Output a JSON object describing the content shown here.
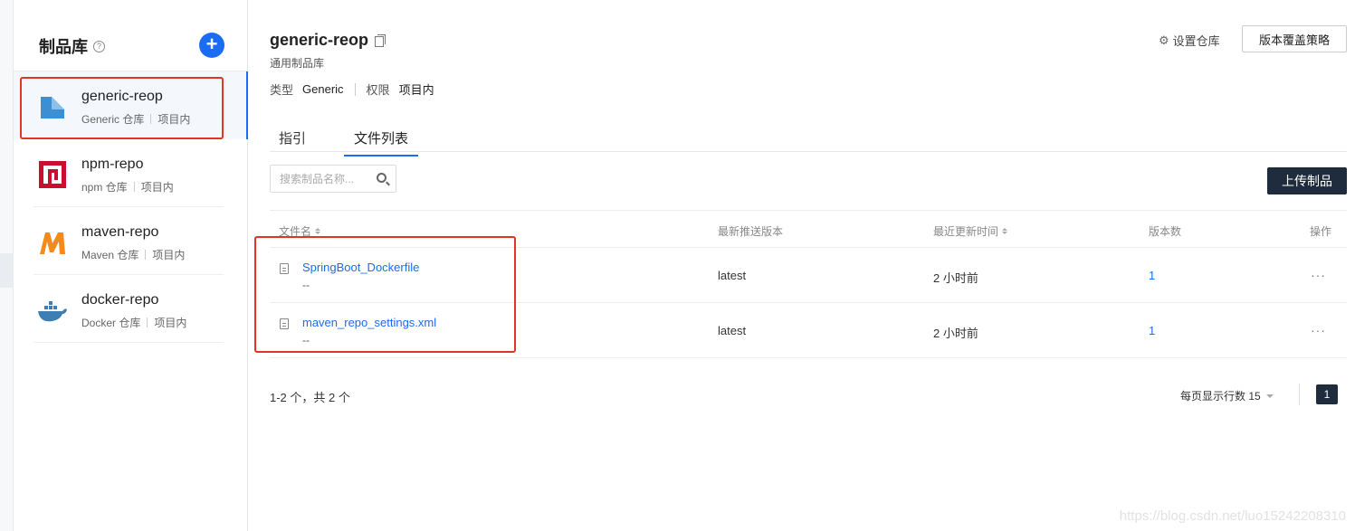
{
  "sidebar": {
    "title": "制品库",
    "help_icon": "?",
    "add_label": "+",
    "items": [
      {
        "name": "generic-reop",
        "type": "Generic 仓库",
        "scope": "项目内",
        "icon": "generic-folder-icon",
        "color": "#3b8fd4"
      },
      {
        "name": "npm-repo",
        "type": "npm 仓库",
        "scope": "项目内",
        "icon": "npm-icon",
        "color": "#c8102e"
      },
      {
        "name": "maven-repo",
        "type": "Maven 仓库",
        "scope": "项目内",
        "icon": "maven-icon",
        "color": "#f28a1e"
      },
      {
        "name": "docker-repo",
        "type": "Docker 仓库",
        "scope": "项目内",
        "icon": "docker-icon",
        "color": "#3d7fb5"
      }
    ]
  },
  "header": {
    "title": "generic-reop",
    "subtitle": "通用制品库",
    "type_label": "类型",
    "type_value": "Generic",
    "perm_label": "权限",
    "perm_value": "项目内",
    "settings_label": "设置仓库",
    "policy_label": "版本覆盖策略"
  },
  "tabs": [
    {
      "label": "指引"
    },
    {
      "label": "文件列表"
    }
  ],
  "toolbar": {
    "search_placeholder": "搜索制品名称...",
    "upload_label": "上传制品"
  },
  "table": {
    "columns": [
      "文件名",
      "最新推送版本",
      "最近更新时间",
      "版本数",
      "操作"
    ],
    "rows": [
      {
        "name": "SpringBoot_Dockerfile",
        "sub": "--",
        "version": "latest",
        "updated": "2 小时前",
        "count": "1",
        "more": "···"
      },
      {
        "name": "maven_repo_settings.xml",
        "sub": "--",
        "version": "latest",
        "updated": "2 小时前",
        "count": "1",
        "more": "···"
      }
    ]
  },
  "pagination": {
    "summary": "1-2 个，共 2 个",
    "page_size_label": "每页显示行数 15",
    "current_page": "1"
  },
  "watermark": "https://blog.csdn.net/luo15242208310",
  "colors": {
    "accent": "#1a6cf2",
    "dark_button": "#1f2c3d",
    "highlight": "#e53228"
  }
}
